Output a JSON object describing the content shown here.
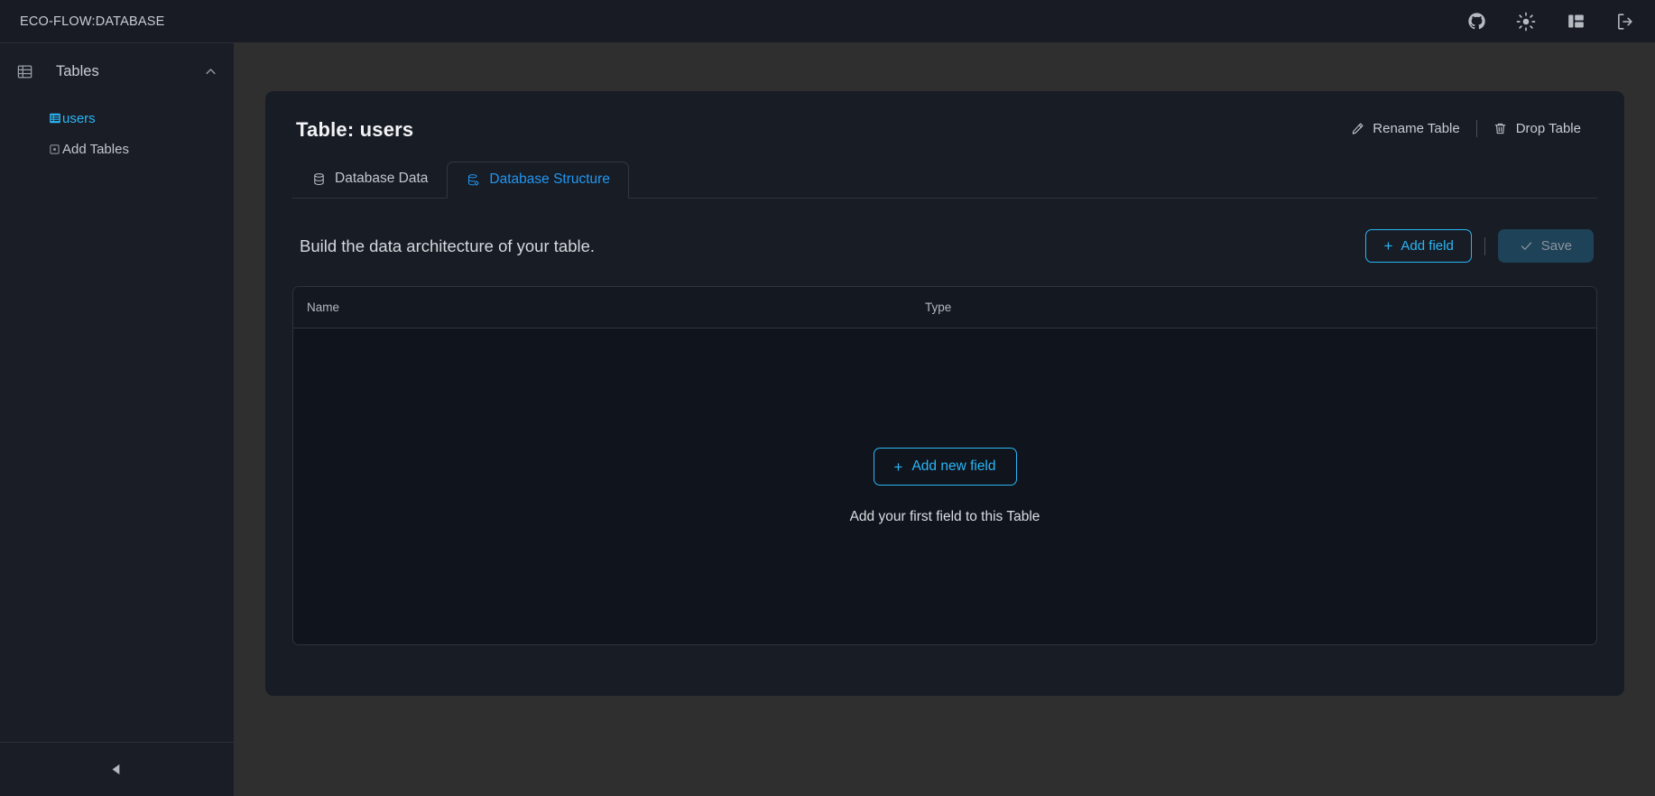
{
  "app": {
    "brand": "ECO-FLOW:DATABASE",
    "accent_blue": "#2196f3",
    "accent_blue_bright": "#29b6f6",
    "panel_bg": "#181b23",
    "page_bg": "#2f2f2f",
    "card_bg": "#181c24"
  },
  "topbar": {
    "icons": [
      {
        "name": "github-icon",
        "label": "GitHub"
      },
      {
        "name": "sun-icon",
        "label": "Toggle theme"
      },
      {
        "name": "layout-panel-icon",
        "label": "Toggle layout"
      },
      {
        "name": "logout-icon",
        "label": "Log out"
      }
    ]
  },
  "sidebar": {
    "header": {
      "title": "Tables",
      "icon": "table-icon",
      "chevron": "chevron-up-icon"
    },
    "items": [
      {
        "label": "users",
        "icon": "table-rows-icon",
        "active": true
      },
      {
        "label": "Add Tables",
        "icon": "add-box-icon",
        "active": false
      }
    ],
    "collapse_icon": "triangle-left-icon"
  },
  "main": {
    "title": "Table: users",
    "head_actions": [
      {
        "label": "Rename Table",
        "icon": "pencil-icon"
      },
      {
        "label": "Drop Table",
        "icon": "trash-icon"
      }
    ],
    "tabs": [
      {
        "label": "Database Data",
        "icon": "database-icon",
        "active": false
      },
      {
        "label": "Database Structure",
        "icon": "database-gear-icon",
        "active": true
      }
    ],
    "subhead": {
      "text": "Build the data architecture of your table.",
      "add_field_label": "Add field",
      "add_field_icon": "plus-icon",
      "save_label": "Save",
      "save_icon": "check-icon",
      "save_disabled": true
    },
    "table": {
      "columns": [
        "Name",
        "Type"
      ],
      "rows": [],
      "empty": {
        "button_label": "Add new field",
        "button_icon": "plus-icon",
        "message": "Add your first field to this Table"
      }
    }
  }
}
